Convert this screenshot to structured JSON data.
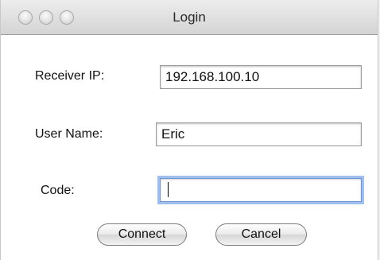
{
  "window": {
    "title": "Login"
  },
  "form": {
    "receiver_ip": {
      "label": "Receiver IP:",
      "value": "192.168.100.10"
    },
    "user_name": {
      "label": "User Name:",
      "value": "Eric"
    },
    "code": {
      "label": "Code:",
      "value": ""
    }
  },
  "buttons": {
    "connect": "Connect",
    "cancel": "Cancel"
  },
  "colors": {
    "focus_ring": "#9fc0ee",
    "titlebar": "#dcdcdc"
  }
}
